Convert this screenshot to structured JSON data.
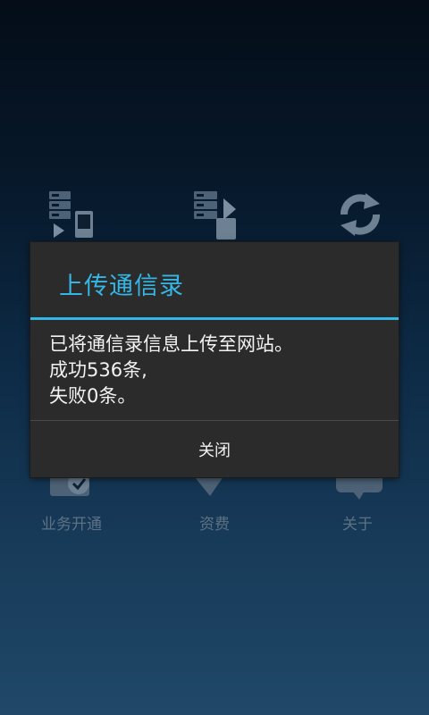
{
  "grid": {
    "row1": [
      {
        "icon": "download-contacts-icon"
      },
      {
        "icon": "upload-contacts-icon"
      },
      {
        "icon": "sync-icon"
      }
    ],
    "row2": [
      {
        "icon": "business-activation-icon",
        "label": "业务开通"
      },
      {
        "icon": "tariff-icon",
        "label": "资费"
      },
      {
        "icon": "about-icon",
        "label": "关于"
      }
    ]
  },
  "dialog": {
    "title": "上传通信录",
    "message_lines": [
      "已将通信录信息上传至网站。",
      "成功536条,",
      "失败0条。"
    ],
    "close_label": "关闭"
  },
  "colors": {
    "accent": "#33b5e5",
    "dialog_bg": "#2b2b2b",
    "icon_muted": "#5d7186"
  }
}
